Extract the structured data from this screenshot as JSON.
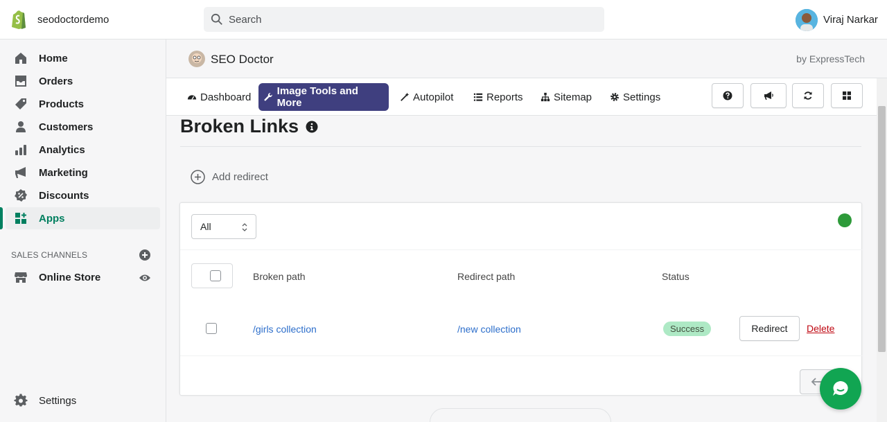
{
  "store": {
    "name": "seodoctordemo"
  },
  "search": {
    "placeholder": "Search"
  },
  "user": {
    "name": "Viraj Narkar"
  },
  "sidebar": {
    "items": [
      {
        "label": "Home",
        "icon": "home-icon"
      },
      {
        "label": "Orders",
        "icon": "orders-icon"
      },
      {
        "label": "Products",
        "icon": "tag-icon"
      },
      {
        "label": "Customers",
        "icon": "person-icon"
      },
      {
        "label": "Analytics",
        "icon": "bar-chart-icon"
      },
      {
        "label": "Marketing",
        "icon": "megaphone-icon"
      },
      {
        "label": "Discounts",
        "icon": "discount-icon"
      },
      {
        "label": "Apps",
        "icon": "apps-icon",
        "active": true
      }
    ],
    "sales_channels_title": "SALES CHANNELS",
    "online_store": "Online Store",
    "settings": "Settings"
  },
  "app": {
    "title": "SEO Doctor",
    "by": "by ExpressTech",
    "tabs": [
      {
        "label": "Dashboard",
        "icon": "dashboard-icon"
      },
      {
        "label": "Image Tools and More",
        "icon": "wrench-icon",
        "active": true
      },
      {
        "label": "Autopilot",
        "icon": "magic-wand-icon"
      },
      {
        "label": "Reports",
        "icon": "list-icon"
      },
      {
        "label": "Sitemap",
        "icon": "sitemap-icon"
      },
      {
        "label": "Settings",
        "icon": "gear-icon"
      }
    ],
    "toolbar_icons": [
      "question-icon",
      "bullhorn-icon",
      "refresh-icon",
      "grid-icon"
    ]
  },
  "page": {
    "title": "Broken Links",
    "add_redirect": "Add redirect",
    "filter_value": "All",
    "columns": [
      "Broken path",
      "Redirect path",
      "Status"
    ],
    "rows": [
      {
        "broken_path": "/girls collection",
        "redirect_path": "/new collection",
        "status": "Success",
        "redirect_button": "Redirect",
        "delete_link": "Delete"
      }
    ]
  },
  "colors": {
    "accent_tab": "#3f3f7f",
    "apps_active": "#007f5f",
    "link": "#2c6ecb",
    "delete": "#bf0711",
    "success_badge": "#aee9c5",
    "status_dot": "#2e9a3a",
    "chat_button": "#11a552"
  }
}
